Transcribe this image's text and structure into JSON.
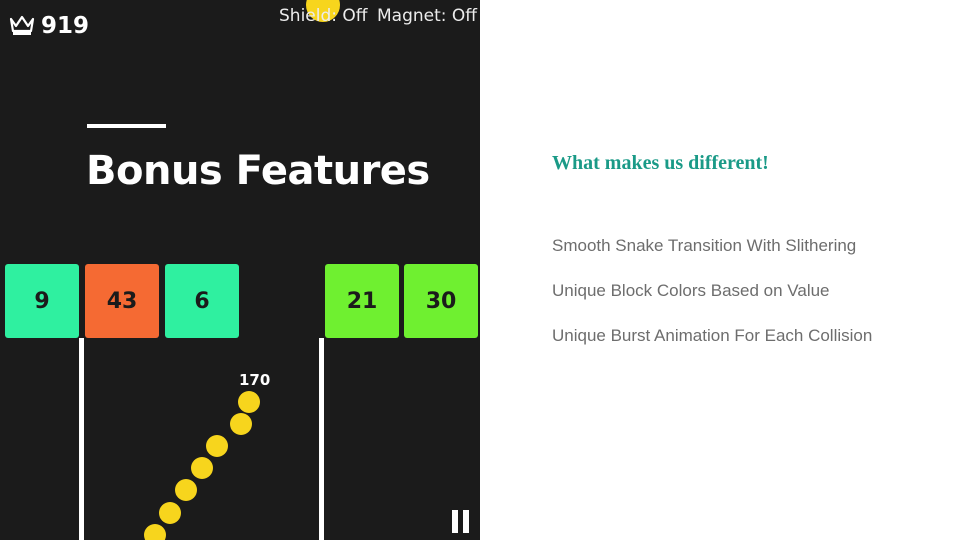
{
  "game": {
    "score": "919",
    "shield_status": "Shield: Off",
    "magnet_status": "Magnet: Off",
    "snake_length": "170",
    "icons": {
      "crown": "crown-icon",
      "pause": "pause-icon"
    },
    "colors": {
      "background": "#1b1b1b",
      "ball": "#f7d51d"
    },
    "blocks": [
      {
        "value": "9",
        "color": "#2ff0a0"
      },
      {
        "value": "43",
        "color": "#f56a33"
      },
      {
        "value": "6",
        "color": "#2ff0a0"
      },
      {
        "value": "21",
        "color": "#6ff030"
      },
      {
        "value": "30",
        "color": "#6ff030"
      }
    ]
  },
  "slide": {
    "title": "Bonus Features",
    "subtitle": "What makes us different!",
    "features": [
      "Smooth Snake Transition With Slithering",
      "Unique Block Colors Based on Value",
      "Unique Burst Animation For Each Collision"
    ],
    "colors": {
      "subtitle": "#1a9a87",
      "feature_text": "#6d6d6d"
    }
  }
}
